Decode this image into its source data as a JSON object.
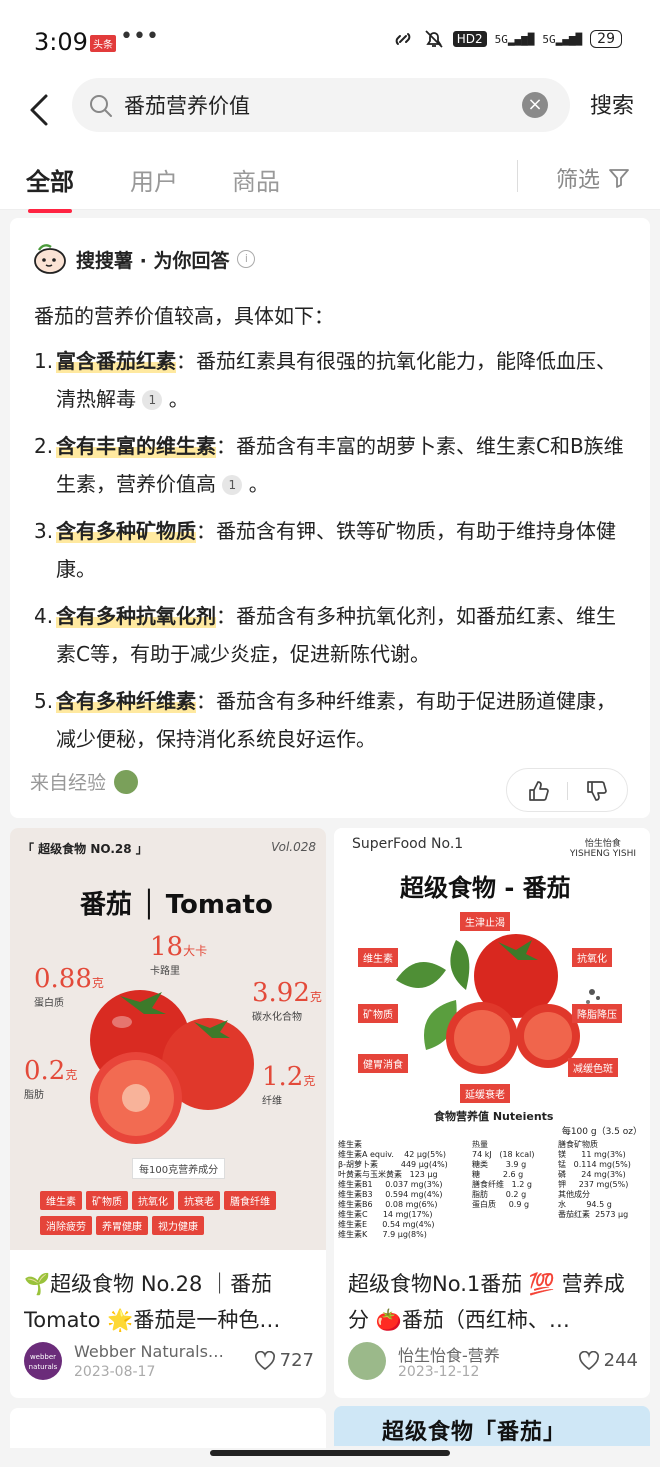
{
  "status": {
    "time": "3:09",
    "news_badge": "头条",
    "dots": "•••",
    "network": "HD2",
    "sig1": "5G",
    "sig2": "5G",
    "battery": "29"
  },
  "search": {
    "query": "番茄营养价值",
    "button": "搜索"
  },
  "tabs": [
    {
      "label": "全部",
      "active": true
    },
    {
      "label": "用户"
    },
    {
      "label": "商品"
    }
  ],
  "filter": "筛选",
  "ai": {
    "title": "搜搜薯 · 为你回答",
    "intro": "番茄的营养价值较高，具体如下：",
    "items": [
      {
        "num": "1.",
        "head": "富含番茄红素",
        "body": "：番茄红素具有很强的抗氧化能力，能降低血压、清热解毒",
        "cite": "1",
        "end": "。"
      },
      {
        "num": "2.",
        "head": "含有丰富的维生素",
        "body": "：番茄含有丰富的胡萝卜素、维生素C和B族维生素，营养价值高",
        "cite": "1",
        "end": "。"
      },
      {
        "num": "3.",
        "head": "含有多种矿物质",
        "body": "：番茄含有钾、铁等矿物质，有助于维持身体健康。"
      },
      {
        "num": "4.",
        "head": "含有多种抗氧化剂",
        "body": "：番茄含有多种抗氧化剂，如番茄红素、维生素C等，有助于减少炎症，促进新陈代谢。"
      },
      {
        "num": "5.",
        "head": "含有多种纤维素",
        "body": "：番茄含有多种纤维素，有助于促进肠道健康，减少便秘，保持消化系统良好运作。"
      }
    ],
    "source": "来自经验"
  },
  "cards": [
    {
      "title": "🌱超级食物 No.28 ｜番茄 Tomato 🌟番茄是一种色…",
      "author": "Webber Naturals…",
      "avatar_text": "webber naturals",
      "date": "2023-08-17",
      "likes": "727",
      "img": {
        "tag": "「 超级食物 NO.28 」",
        "sig": "Vol.028",
        "heading": "番茄 │ Tomato",
        "nutrients": [
          {
            "v": "18",
            "u": "大卡",
            "l": "卡路里"
          },
          {
            "v": "0.88",
            "u": "克",
            "l": "蛋白质"
          },
          {
            "v": "3.92",
            "u": "克",
            "l": "碳水化合物"
          },
          {
            "v": "0.2",
            "u": "克",
            "l": "脂肪"
          },
          {
            "v": "1.2",
            "u": "克",
            "l": "纤维"
          }
        ],
        "per": "每100克营养成分",
        "pills": [
          "维生素",
          "矿物质",
          "抗氧化",
          "抗衰老",
          "膳食纤维",
          "消除疲劳",
          "养胃健康",
          "视力健康"
        ]
      }
    },
    {
      "title": "超级食物No.1番茄 💯 营养成分 🍅番茄（西红柿、…",
      "author": "怡生怡食-营养",
      "date": "2023-12-12",
      "likes": "244",
      "img": {
        "sf": "SuperFood No.1",
        "brand1": "怡生怡食",
        "brand2": "YISHENG YISHI",
        "heading": "超级食物 - 番茄",
        "labels": [
          "生津止渴",
          "维生素",
          "抗氧化",
          "矿物质",
          "降脂降压",
          "健胃消食",
          "减缓色斑",
          "延缓衰老"
        ],
        "nutri_title": "食物营养值 Nuteients",
        "per": "每100 g（3.5 oz）",
        "col1": "维生素\n维生素A equiv.    42 μg(5%)\nβ-胡萝卜素         449 μg(4%)\n叶黄素与玉米黄素   123 μg\n维生素B1     0.037 mg(3%)\n维生素B3     0.594 mg(4%)\n维生素B6     0.08 mg(6%)\n维生素C      14 mg(17%)\n维生素E      0.54 mg(4%)\n维生素K      7.9 μg(8%)",
        "col2": "热量\n74 kJ   (18 kcal)\n糖类       3.9 g\n糖         2.6 g\n膳食纤维   1.2 g\n脂肪       0.2 g\n蛋白质     0.9 g",
        "col3": "膳食矿物质\n镁      11 mg(3%)\n锰   0.114 mg(5%)\n磷      24 mg(3%)\n钾     237 mg(5%)\n其他成分\n水        94.5 g\n番茄红素  2573 μg"
      }
    }
  ],
  "banner": "超级食物「番茄」",
  "colors": {
    "accent": "#ff2442",
    "tomato": "#e5443a",
    "highlight": "#ffe9a0"
  }
}
